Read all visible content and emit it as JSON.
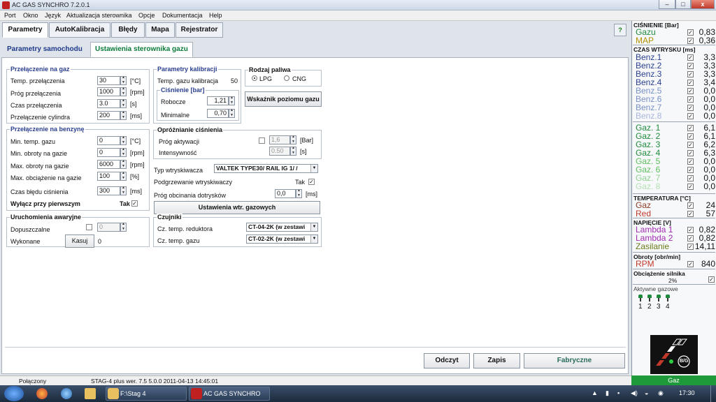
{
  "window": {
    "title": "AC GAS SYNCHRO  7.2.0.1",
    "minimize": "–",
    "maximize": "□",
    "close": "x"
  },
  "menu": [
    "Port",
    "Okno",
    "Język",
    "Aktualizacja sterownika",
    "Opcje",
    "Dokumentacja",
    "Help"
  ],
  "tabs": [
    "Parametry",
    "AutoKalibracja",
    "Błędy",
    "Mapa",
    "Rejestrator"
  ],
  "help_icon": "help-icon",
  "subtabs": [
    "Parametry samochodu",
    "Ustawienia sterownika gazu"
  ],
  "switch_to_gas": {
    "title": "Przełączenie na gaz",
    "rows": [
      {
        "label": "Temp. przełączenia",
        "value": "30",
        "unit": "[°C]"
      },
      {
        "label": "Próg przełączenia",
        "value": "1000",
        "unit": "[rpm]"
      },
      {
        "label": "Czas przełączenia",
        "value": "3.0",
        "unit": "[s]"
      },
      {
        "label": "Przełączenie cylindra",
        "value": "200",
        "unit": "[ms]"
      }
    ]
  },
  "switch_to_petrol": {
    "title": "Przełączenie na benzynę",
    "rows": [
      {
        "label": "Min. temp. gazu",
        "value": "0",
        "unit": "[°C]"
      },
      {
        "label": "Min. obroty na gazie",
        "value": "0",
        "unit": "[rpm]"
      },
      {
        "label": "Max. obroty na gazie",
        "value": "6000",
        "unit": "[rpm]"
      },
      {
        "label": "Max. obciążenie na gazie",
        "value": "100",
        "unit": "[%]"
      }
    ],
    "pressure_error_label": "Czas błędu ciśnienia",
    "pressure_error_value": "300",
    "pressure_error_unit": "[ms]",
    "disable_first_label": "Wyłącz przy pierwszym",
    "disable_first_value": "Tak",
    "disable_first_check": "✓"
  },
  "emergency": {
    "title": "Uruchomienia awaryjne",
    "allowed_label": "Dopuszczalne",
    "allowed_value": "0",
    "done_label": "Wykonane",
    "reset_button": "Kasuj",
    "done_value": "0"
  },
  "calibration": {
    "title": "Parametry kalibracji",
    "temp_label": "Temp. gazu kalibracja",
    "temp_value": "50",
    "pressure_title": "Ciśnienie [bar]",
    "working_label": "Robocze",
    "working_value": "1,21",
    "minimal_label": "Minimalne",
    "minimal_value": "0,70"
  },
  "fuel_type": {
    "title": "Rodzaj paliwa",
    "option1": "LPG",
    "option2": "CNG"
  },
  "gauge_button": "Wskaźnik poziomu gazu",
  "pressure_release": {
    "title": "Opróżnianie ciśnienia",
    "threshold_label": "Próg aktywacji",
    "threshold_value": "1,6",
    "threshold_unit": "[Bar]",
    "intensity_label": "Intensywność",
    "intensity_value": "0.50",
    "intensity_unit": "[s]"
  },
  "injector": {
    "type_label": "Typ wtryskiwacza",
    "type_value": "VALTEK TYPE30/ RAIL IG 1/ /",
    "heating_label": "Podgrzewanie wtryskiwaczy",
    "heating_value": "Tak",
    "heating_check": "✓",
    "cutoff_label": "Próg obcinania dotrysków",
    "cutoff_value": "0,0",
    "cutoff_unit": "[ms]",
    "settings_button": "Ustawienia wtr. gazowych"
  },
  "sensors": {
    "title": "Czujniki",
    "reducer_label": "Cz. temp. reduktora",
    "reducer_value": "CT-04-2K (w zestawi",
    "gas_label": "Cz. temp. gazu",
    "gas_value": "CT-02-2K (w zestawi"
  },
  "bottom_buttons": {
    "read": "Odczyt",
    "save": "Zapis",
    "factory": "Fabryczne"
  },
  "status": {
    "connection": "Połączony",
    "device": "STAG-4 plus  wer. 7.5  5.0.0   2011-04-13 14:45:01"
  },
  "side": {
    "pressure_title": "CIŚNIENIE [Bar]",
    "pressure": [
      {
        "name": "Gazu",
        "value": "0,83",
        "color": "#1e8a3a"
      },
      {
        "name": "MAP",
        "value": "0,36",
        "color": "#b09000"
      }
    ],
    "injection_title": "CZAS WTRYSKU  [ms]",
    "benz": [
      {
        "name": "Benz.1",
        "value": "3,3",
        "color": "#2a3f8f"
      },
      {
        "name": "Benz.2",
        "value": "3,3",
        "color": "#2a3f8f"
      },
      {
        "name": "Benz.3",
        "value": "3,3",
        "color": "#2a3f8f"
      },
      {
        "name": "Benz.4",
        "value": "3,4",
        "color": "#2a3f8f"
      },
      {
        "name": "Benz.5",
        "value": "0,0",
        "color": "#7a90c8"
      },
      {
        "name": "Benz.6",
        "value": "0,0",
        "color": "#7a90c8"
      },
      {
        "name": "Benz.7",
        "value": "0,0",
        "color": "#7a90c8"
      },
      {
        "name": "Benz.8",
        "value": "0,0",
        "color": "#a8b4dc"
      }
    ],
    "gaz": [
      {
        "name": "Gaz. 1",
        "value": "6,1",
        "color": "#1e8a3a"
      },
      {
        "name": "Gaz. 2",
        "value": "6,1",
        "color": "#1e8a3a"
      },
      {
        "name": "Gaz. 3",
        "value": "6,2",
        "color": "#1e8a3a"
      },
      {
        "name": "Gaz. 4",
        "value": "6,3",
        "color": "#1e8a3a"
      },
      {
        "name": "Gaz. 5",
        "value": "0,0",
        "color": "#5cbf5c"
      },
      {
        "name": "Gaz. 6",
        "value": "0,0",
        "color": "#5cbf5c"
      },
      {
        "name": "Gaz. 7",
        "value": "0,0",
        "color": "#8ed08e"
      },
      {
        "name": "Gaz. 8",
        "value": "0,0",
        "color": "#b6e0b6"
      }
    ],
    "temperature_title": "TEMPERATURA  [°C]",
    "temperature": [
      {
        "name": "Gaz",
        "value": "24",
        "color": "#8a3a1e"
      },
      {
        "name": "Red",
        "value": "57",
        "color": "#c0392b"
      }
    ],
    "voltage_title": "NAPIĘCIE [V]",
    "voltage": [
      {
        "name": "Lambda 1",
        "value": "0,82",
        "color": "#a02ab0"
      },
      {
        "name": "Lambda 2",
        "value": "0,82",
        "color": "#a02ab0"
      },
      {
        "name": "Zasilanie",
        "value": "14,11",
        "color": "#6a7a1a"
      }
    ],
    "rpm_title": "Obroty [obr/min]",
    "rpm": {
      "name": "RPM",
      "value": "840",
      "color": "#c0392b"
    },
    "load_title": "Obciążenie silnika",
    "load_value": "2%",
    "active_title": "Aktywne gazowe",
    "active": [
      "1",
      "2",
      "3",
      "4"
    ],
    "check": "✓"
  },
  "logo_text": "B/G",
  "gas_state": "Gaz",
  "taskbar": {
    "item1": "F:\\Stag 4",
    "item2": "AC GAS SYNCHRO",
    "clock": "17:30"
  }
}
